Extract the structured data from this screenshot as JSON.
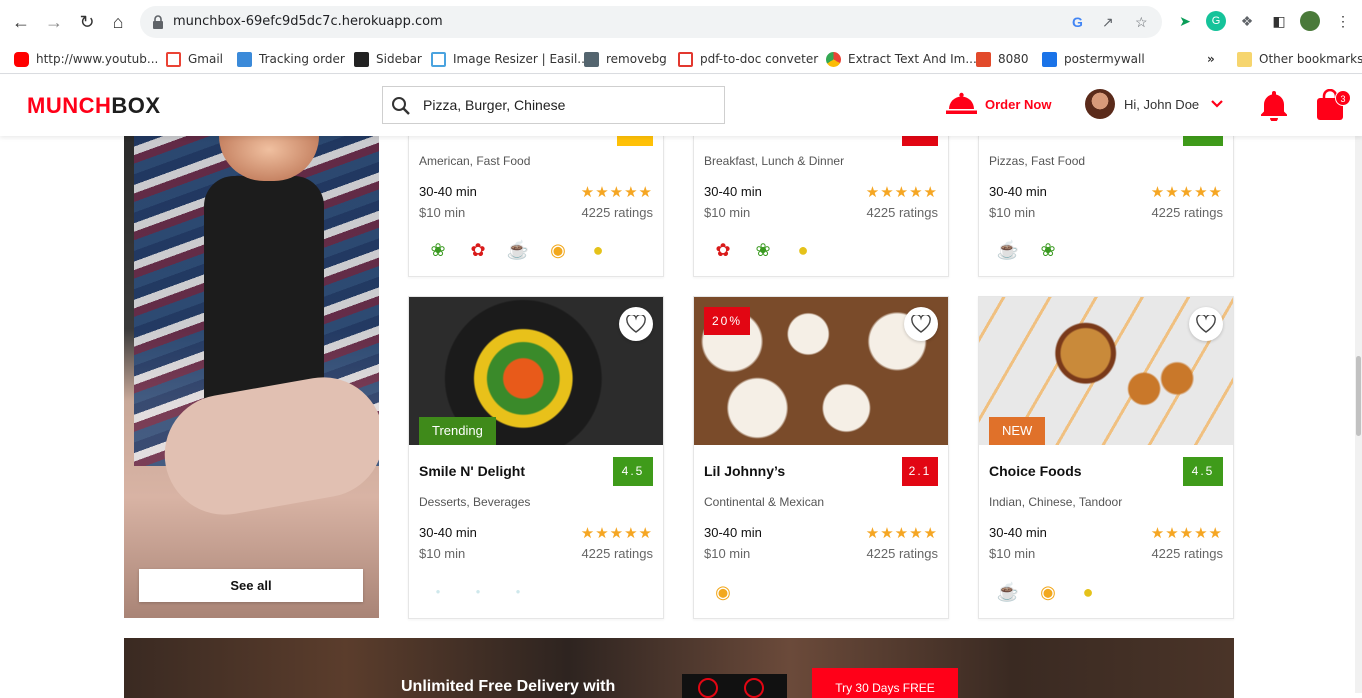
{
  "browser": {
    "url": "munchbox-69efc9d5dc7c.herokuapp.com",
    "bookmarks": [
      {
        "label": "http://www.youtub...",
        "color": "#ff0000"
      },
      {
        "label": "Gmail",
        "color": "#ea4335"
      },
      {
        "label": "Tracking order",
        "color": "#3b8ad9"
      },
      {
        "label": "Sidebar",
        "color": "#222222"
      },
      {
        "label": "Image Resizer | Easil...",
        "color": "#4aa3df"
      },
      {
        "label": "removebg",
        "color": "#54656f"
      },
      {
        "label": "pdf-to-doc conveter",
        "color": "#e2382f"
      },
      {
        "label": "Extract Text And Im...",
        "color": "#34a853"
      },
      {
        "label": "8080",
        "color": "#e24a2b"
      },
      {
        "label": "postermywall",
        "color": "#1a73e8"
      }
    ],
    "more": "»",
    "other_bookmarks": "Other bookmarks"
  },
  "header": {
    "logo_part1": "MUNCH",
    "logo_part2": "BOX",
    "search_value": "Pizza, Burger, Chinese",
    "order_now": "Order Now",
    "user_greeting": "Hi, John Doe",
    "cart_count": "3"
  },
  "side_banner": {
    "button": "See all"
  },
  "cards_top": [
    {
      "cuisine": "American, Fast Food",
      "time": "30-40 min",
      "min_price": "$10 min",
      "stars": "★★★★★",
      "ratings": "4225 ratings",
      "icons": [
        "leaf",
        "chili",
        "chef",
        "egg",
        "lemon"
      ],
      "accent": "#ffc107"
    },
    {
      "cuisine": "Breakfast, Lunch & Dinner",
      "time": "30-40 min",
      "min_price": "$10 min",
      "stars": "★★★★★",
      "ratings": "4225 ratings",
      "icons": [
        "chili",
        "leaf",
        "lemon"
      ],
      "accent": "#e20613"
    },
    {
      "cuisine": "Pizzas, Fast Food",
      "time": "30-40 min",
      "min_price": "$10 min",
      "stars": "★★★★★",
      "ratings": "4225 ratings",
      "icons": [
        "chef",
        "leaf"
      ],
      "accent": "#3f9b1a"
    }
  ],
  "cards_bottom": [
    {
      "name": "Smile N' Delight",
      "rating": "4.5",
      "rating_color": "#3f9b1a",
      "ribbon": "Trending",
      "ribbon_color": "#3f8a1a",
      "cuisine": "Desserts, Beverages",
      "time": "30-40 min",
      "min_price": "$10 min",
      "stars": "★★★★★",
      "ratings": "4225 ratings",
      "icons": []
    },
    {
      "name": "Lil Johnny’s",
      "rating": "2.1",
      "rating_color": "#e20613",
      "discount": "20%",
      "cuisine": "Continental & Mexican",
      "time": "30-40 min",
      "min_price": "$10 min",
      "stars": "★★★★★",
      "ratings": "4225 ratings",
      "icons": [
        "egg"
      ]
    },
    {
      "name": "Choice Foods",
      "rating": "4.5",
      "rating_color": "#3f9b1a",
      "ribbon": "NEW",
      "ribbon_color": "#e0712a",
      "cuisine": "Indian, Chinese, Tandoor",
      "time": "30-40 min",
      "min_price": "$10 min",
      "stars": "★★★★★",
      "ratings": "4225 ratings",
      "icons": [
        "chef",
        "egg",
        "lemon"
      ]
    }
  ],
  "promo": {
    "text": "Unlimited Free Delivery with",
    "button": "Try 30 Days FREE"
  }
}
